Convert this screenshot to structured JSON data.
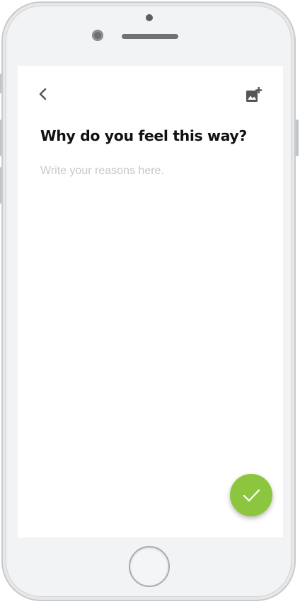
{
  "colors": {
    "accent": "#8cc63f",
    "title_text": "#111111",
    "placeholder_text": "#c6c8ca",
    "icon": "#555555",
    "screen_background": "#ffffff",
    "device_body": "#f2f3f4"
  },
  "header": {
    "back_icon": "chevron-left-icon",
    "add_image_icon": "add-photo-icon"
  },
  "prompt": {
    "title": "Why do you feel this way?"
  },
  "reasons_input": {
    "value": "",
    "placeholder": "Write your reasons here."
  },
  "confirm": {
    "icon": "checkmark-icon"
  }
}
